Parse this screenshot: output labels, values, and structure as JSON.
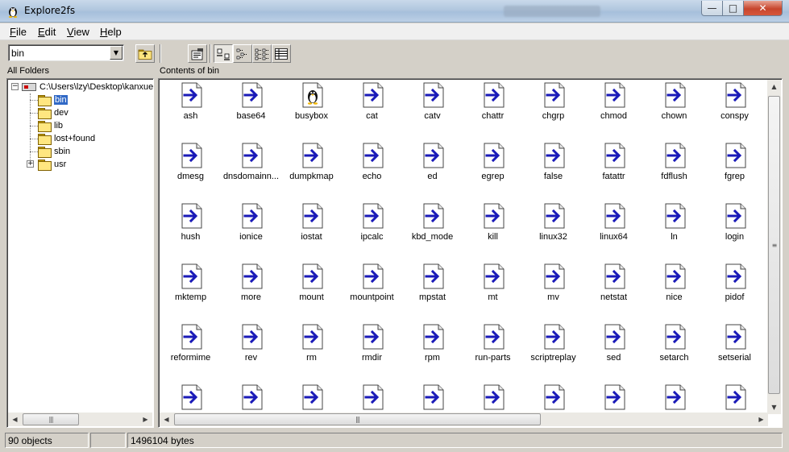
{
  "window": {
    "title": "Explore2fs",
    "blurred_title": "",
    "controls": {
      "minimize": "—",
      "maximize": "□",
      "close": "✕"
    }
  },
  "menu": [
    {
      "label": "File",
      "accel": "F",
      "rest": "ile"
    },
    {
      "label": "Edit",
      "accel": "E",
      "rest": "dit"
    },
    {
      "label": "View",
      "accel": "V",
      "rest": "iew"
    },
    {
      "label": "Help",
      "accel": "H",
      "rest": "elp"
    }
  ],
  "toolbar": {
    "path_combo_value": "bin",
    "buttons": [
      "up-folder-icon",
      "properties-icon",
      "large-icons-view-icon",
      "small-icons-view-icon",
      "list-view-icon",
      "details-view-icon"
    ]
  },
  "left_pane": {
    "header": "All Folders",
    "root_path": "C:\\Users\\lzy\\Desktop\\kanxue",
    "folders": [
      {
        "name": "bin",
        "selected": true,
        "expandable": false
      },
      {
        "name": "dev",
        "selected": false,
        "expandable": false
      },
      {
        "name": "lib",
        "selected": false,
        "expandable": false
      },
      {
        "name": "lost+found",
        "selected": false,
        "expandable": false
      },
      {
        "name": "sbin",
        "selected": false,
        "expandable": false
      },
      {
        "name": "usr",
        "selected": false,
        "expandable": true
      }
    ]
  },
  "right_pane": {
    "header": "Contents of bin",
    "files": [
      [
        "ash",
        "base64",
        "busybox",
        "cat",
        "catv",
        "chattr",
        "chgrp",
        "chmod",
        "chown",
        "conspy"
      ],
      [
        "dmesg",
        "dnsdomainn...",
        "dumpkmap",
        "echo",
        "ed",
        "egrep",
        "false",
        "fatattr",
        "fdflush",
        "fgrep"
      ],
      [
        "hush",
        "ionice",
        "iostat",
        "ipcalc",
        "kbd_mode",
        "kill",
        "linux32",
        "linux64",
        "ln",
        "login"
      ],
      [
        "mktemp",
        "more",
        "mount",
        "mountpoint",
        "mpstat",
        "mt",
        "mv",
        "netstat",
        "nice",
        "pidof"
      ],
      [
        "reformime",
        "rev",
        "rm",
        "rmdir",
        "rpm",
        "run-parts",
        "scriptreplay",
        "sed",
        "setarch",
        "setserial"
      ],
      [
        "",
        "",
        "",
        "",
        "",
        "",
        "",
        "",
        "",
        ""
      ]
    ],
    "special_icon_file": "busybox"
  },
  "status": {
    "objects": "90 objects",
    "bytes": "1496104 bytes"
  },
  "colors": {
    "selection": "#3169c6",
    "arrow_blue": "#1a1ab8",
    "face": "#d4d0c8"
  }
}
